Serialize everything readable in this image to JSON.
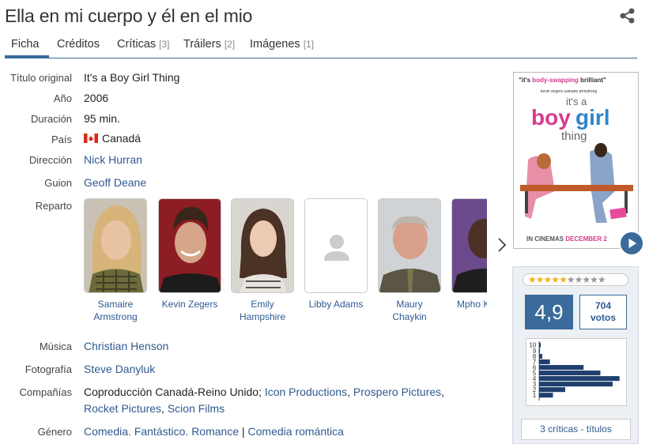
{
  "title": "Ella en mi cuerpo y él en el mio",
  "tabs": [
    {
      "label": "Ficha",
      "count": ""
    },
    {
      "label": "Créditos",
      "count": ""
    },
    {
      "label": "Críticas",
      "count": "[3]"
    },
    {
      "label": "Tráilers",
      "count": "[2]"
    },
    {
      "label": "Imágenes",
      "count": "[1]"
    }
  ],
  "fields": {
    "original_title": {
      "label": "Título original",
      "value": "It's a Boy Girl Thing"
    },
    "year": {
      "label": "Año",
      "value": "2006"
    },
    "duration": {
      "label": "Duración",
      "value": "95 min."
    },
    "country": {
      "label": "País",
      "value": "Canadá"
    },
    "director": {
      "label": "Dirección",
      "value": "Nick Hurran"
    },
    "writer": {
      "label": "Guion",
      "value": "Geoff Deane"
    },
    "cast": {
      "label": "Reparto"
    },
    "music": {
      "label": "Música",
      "value": "Christian Henson"
    },
    "photography": {
      "label": "Fotografía",
      "value": "Steve Danyluk"
    },
    "companies": {
      "label": "Compañías",
      "prefix": "Coproducción Canadá-Reino Unido;",
      "c1": "Icon Productions",
      "c2": "Prospero Pictures",
      "c3": "Rocket Pictures",
      "c4": "Scion Films",
      "sep": ","
    },
    "genre": {
      "label": "Género",
      "g1": "Comedia.",
      "g2": "Fantástico.",
      "g3": "Romance",
      "sep": "|",
      "g4": "Comedia romántica"
    }
  },
  "cast": [
    {
      "line1": "Samaire",
      "line2": "Armstrong"
    },
    {
      "line1": "Kevin Zegers",
      "line2": ""
    },
    {
      "line1": "Emily",
      "line2": "Hampshire"
    },
    {
      "line1": "Libby Adams",
      "line2": ""
    },
    {
      "line1": "Maury Chaykin",
      "line2": ""
    },
    {
      "line1": "Mpho K",
      "line2": ""
    }
  ],
  "poster": {
    "tagline_quote": "\"it's ",
    "tagline_mid": "body-swapping",
    "tagline_end": " brilliant\"",
    "names": "kevin zegers     samaire armstrong",
    "its_a": "it's a",
    "boy": "boy",
    "girl": "girl",
    "thing": "thing",
    "bottom": "IN CINEMAS ",
    "bottom_date": "DECEMBER 2"
  },
  "rating": {
    "score": "4,9",
    "votes": "704",
    "votes_label": "votos",
    "stars_filled": 5,
    "stars_total": 10,
    "histogram_labels": [
      "10",
      "9",
      "8",
      "7",
      "6",
      "5",
      "4",
      "3",
      "2",
      "1"
    ],
    "histogram": [
      2,
      1,
      4,
      14,
      58,
      80,
      105,
      96,
      34,
      18
    ],
    "critics_link": "3 críticas - títulos"
  },
  "colors": {
    "accent": "#3a6b9a",
    "link": "#2f5a90",
    "star": "#f2b01e"
  }
}
